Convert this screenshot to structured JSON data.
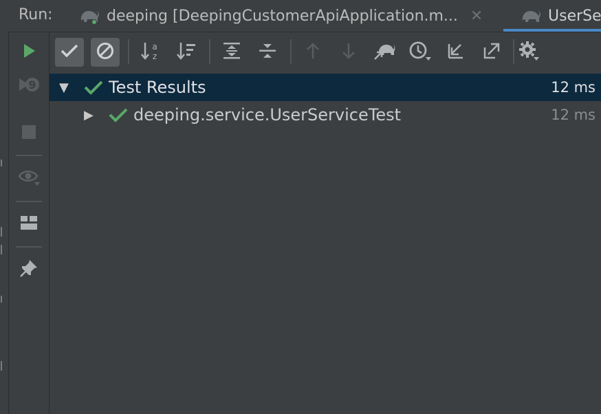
{
  "colors": {
    "background": "#3c3f41",
    "selection": "#0d293e",
    "accent_tab": "#4a88c7",
    "pass_green": "#59a869",
    "icon_gray": "#afb1b3"
  },
  "run_bar": {
    "label": "Run:",
    "tabs": [
      {
        "label": "deeping [DeepingCustomerApiApplication.m...",
        "icon": "gradle-elephant-icon"
      },
      {
        "label": "UserSe",
        "icon": "gradle-elephant-icon"
      }
    ],
    "close_glyph": "✕"
  },
  "toolbar": {
    "buttons": [
      {
        "name": "show-passed-button",
        "icon": "check-icon",
        "active": true
      },
      {
        "name": "show-ignored-button",
        "icon": "ignored-icon",
        "active": true
      },
      {
        "name": "sort-alphabetically-button",
        "icon": "sort-az-icon"
      },
      {
        "name": "sort-by-duration-button",
        "icon": "sort-duration-icon"
      },
      {
        "name": "expand-all-button",
        "icon": "expand-all-icon"
      },
      {
        "name": "collapse-all-button",
        "icon": "collapse-all-icon"
      },
      {
        "name": "previous-failed-button",
        "icon": "arrow-up-icon"
      },
      {
        "name": "next-failed-button",
        "icon": "arrow-down-icon"
      },
      {
        "name": "import-tests-button",
        "icon": "gradle-import-icon"
      },
      {
        "name": "test-history-button",
        "icon": "history-icon"
      },
      {
        "name": "import-results-button",
        "icon": "import-icon"
      },
      {
        "name": "export-results-button",
        "icon": "export-icon"
      },
      {
        "name": "settings-button",
        "icon": "gear-icon"
      }
    ]
  },
  "side_toolbar": {
    "buttons": [
      {
        "name": "rerun-button",
        "icon": "play-icon"
      },
      {
        "name": "rerun-failed-button",
        "icon": "rerun-failed-icon"
      },
      {
        "name": "stop-button",
        "icon": "stop-icon"
      },
      {
        "name": "view-options-button",
        "icon": "eye-icon"
      },
      {
        "name": "layout-button",
        "icon": "layout-icon"
      },
      {
        "name": "pin-tab-button",
        "icon": "pin-icon"
      }
    ]
  },
  "results": {
    "root": {
      "label": "Test Results",
      "duration": "12 ms",
      "status": "passed",
      "expanded": true
    },
    "children": [
      {
        "label": "deeping.service.UserServiceTest",
        "duration": "12 ms",
        "status": "passed",
        "expanded": false
      }
    ]
  }
}
